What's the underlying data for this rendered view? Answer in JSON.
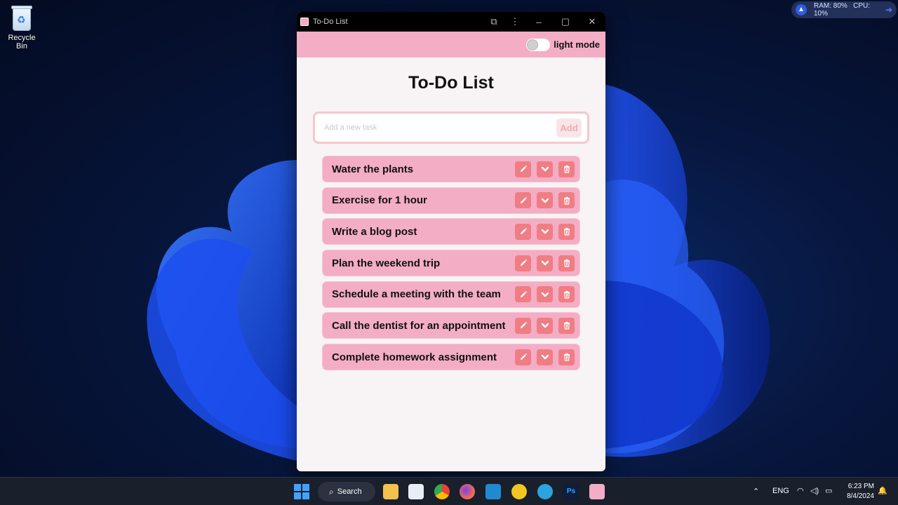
{
  "desktop": {
    "recycle_bin_label": "Recycle Bin"
  },
  "resource_monitor": {
    "ram_label": "RAM: 80%",
    "cpu_label": "CPU: 10%"
  },
  "window": {
    "title": "To-Do List",
    "theme_toggle_label": "light mode"
  },
  "app": {
    "heading": "To-Do List",
    "new_task_placeholder": "Add a new task",
    "new_task_value": "",
    "add_button_label": "Add",
    "tasks": [
      {
        "text": "Water the plants"
      },
      {
        "text": "Exercise for 1 hour"
      },
      {
        "text": "Write a blog post"
      },
      {
        "text": "Plan the weekend trip"
      },
      {
        "text": "Schedule a meeting with the team"
      },
      {
        "text": "Call the dentist for an appointment"
      },
      {
        "text": "Complete homework assignment"
      }
    ]
  },
  "taskbar": {
    "search_label": "Search",
    "language": "ENG",
    "time": "6:23 PM",
    "date": "8/4/2024"
  },
  "colors": {
    "accent_pink": "#f3aec6",
    "action_button": "#f07d84",
    "window_bg": "#f8f3f4"
  }
}
